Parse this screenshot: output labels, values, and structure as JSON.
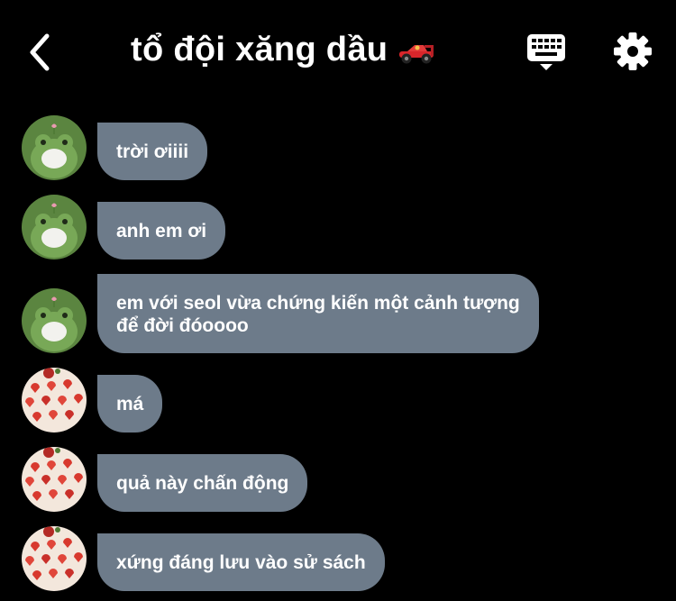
{
  "header": {
    "title": "tổ đội xăng dầu",
    "title_emoji_icon": "racing-car-icon",
    "back_icon": "chevron-left-icon",
    "keyboard_icon": "keyboard-icon",
    "settings_icon": "gear-icon"
  },
  "colors": {
    "background": "#000000",
    "bubble": "#6d7b8a",
    "text": "#ffffff",
    "frog_green": "#6f9d4f"
  },
  "messages": [
    {
      "sender_avatar": "frog-avatar",
      "text": "trời ơiiii"
    },
    {
      "sender_avatar": "frog-avatar",
      "text": "anh em ơi"
    },
    {
      "sender_avatar": "frog-avatar",
      "text": "em với seol vừa chứng kiến một cảnh tượng\nđể đời đóoooo"
    },
    {
      "sender_avatar": "strawberry-avatar",
      "text": "má"
    },
    {
      "sender_avatar": "strawberry-avatar",
      "text": "quả này chấn động"
    },
    {
      "sender_avatar": "strawberry-avatar",
      "text": "xứng đáng lưu vào sử sách"
    }
  ]
}
